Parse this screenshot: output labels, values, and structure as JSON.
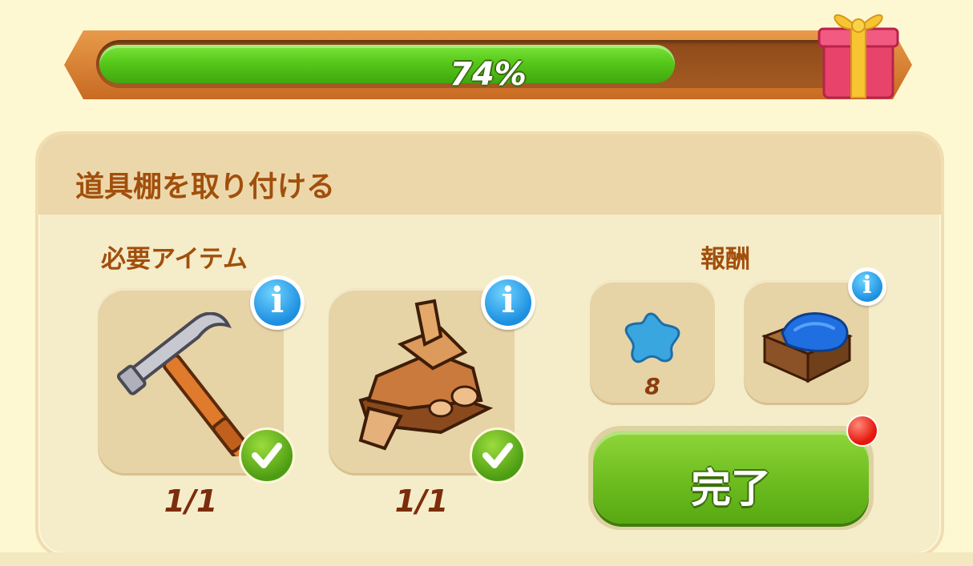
{
  "progress": {
    "value": 0.74,
    "label": "74%"
  },
  "task": {
    "title": "道具棚を取り付ける"
  },
  "required": {
    "label": "必要アイテム",
    "items": [
      {
        "icon": "hammer-icon",
        "count": "1/1"
      },
      {
        "icon": "firewood-icon",
        "count": "1/1"
      }
    ]
  },
  "reward": {
    "label": "報酬",
    "items": [
      {
        "icon": "blue-star-icon",
        "count": "8"
      },
      {
        "icon": "cloth-crate-icon"
      }
    ]
  },
  "complete_button": {
    "label": "完了"
  },
  "colors": {
    "accent_text": "#a14f0c",
    "progress_green": "#57c91a",
    "button_green": "#6dbd20"
  }
}
